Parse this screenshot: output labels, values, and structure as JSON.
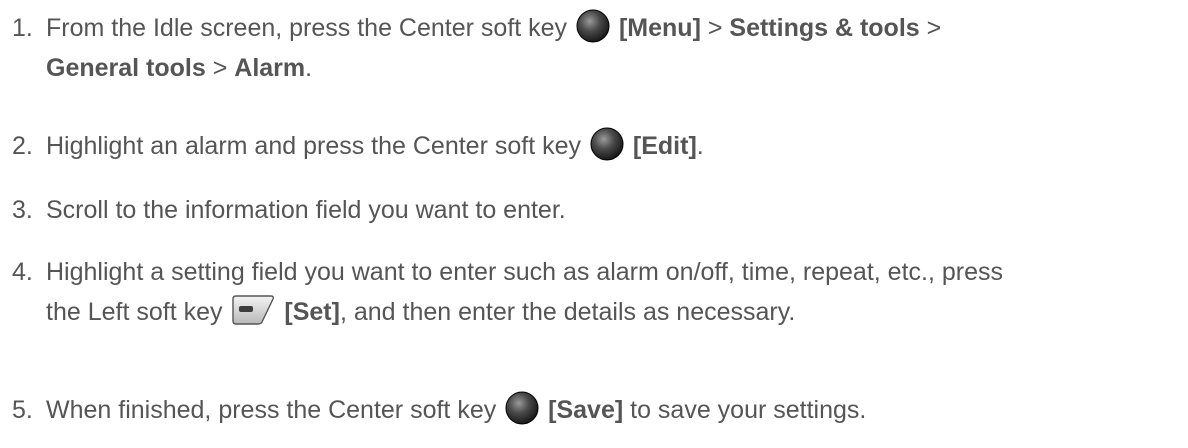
{
  "steps": [
    {
      "number": "1.",
      "t1": "From the Idle screen, press the Center soft key",
      "key_icon": "center-soft-key-icon",
      "b1": "[Menu]",
      "sep1": " > ",
      "b2": "Settings & tools",
      "sep2": " >",
      "b3": "General tools",
      "sep3": " > ",
      "b4": "Alarm",
      "end": "."
    },
    {
      "number": "2.",
      "t1": "Highlight an alarm and press the Center soft key",
      "key_icon": "center-soft-key-icon",
      "b1": "[Edit]",
      "end": "."
    },
    {
      "number": "3.",
      "t1": "Scroll to the information field you want to enter."
    },
    {
      "number": "4.",
      "t1": "Highlight a setting field you want to enter such as alarm on/off, time, repeat, etc., press",
      "t2": "the Left soft key",
      "key_icon": "left-soft-key-icon",
      "b1": "[Set]",
      "t3": ", and then enter the details as necessary."
    },
    {
      "number": "5.",
      "t1": "When finished, press the Center soft key",
      "key_icon": "center-soft-key-icon",
      "b1": "[Save]",
      "t2": " to save your settings."
    }
  ]
}
